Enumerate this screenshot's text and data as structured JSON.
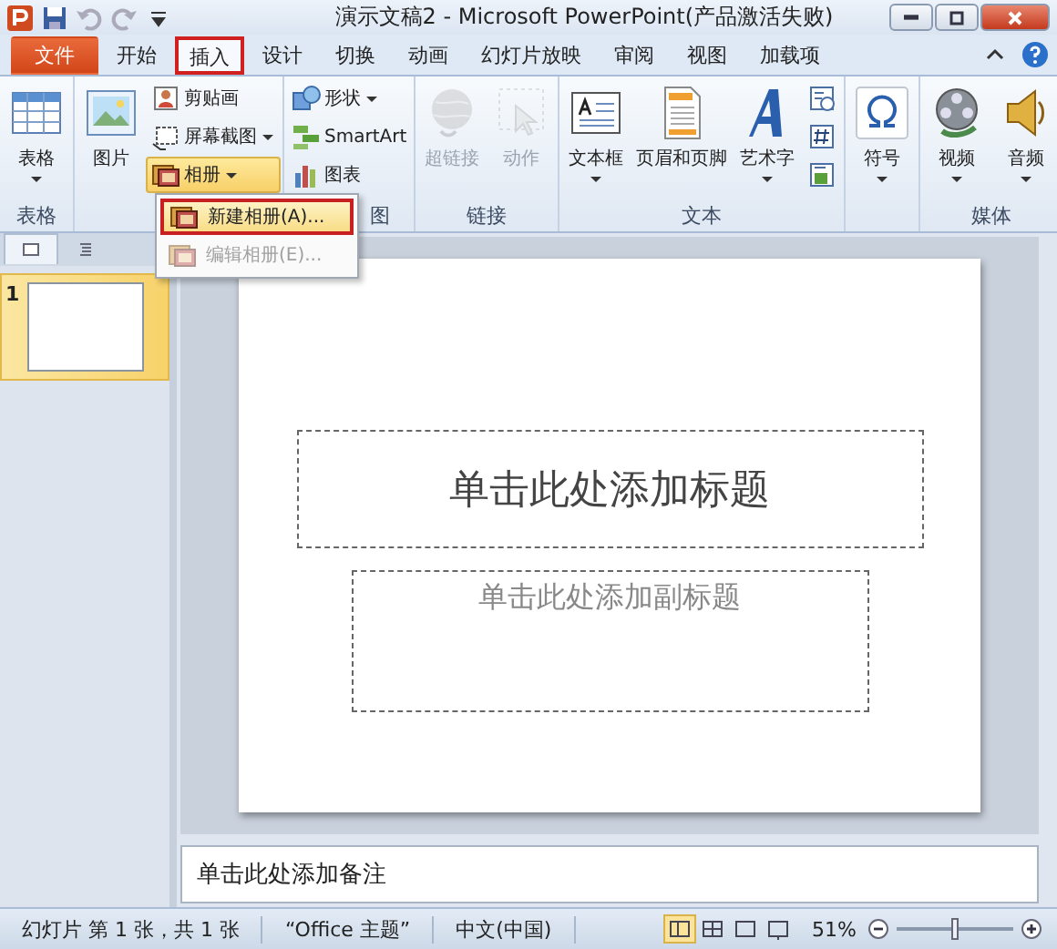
{
  "window": {
    "title": "演示文稿2 - Microsoft PowerPoint(产品激活失败)"
  },
  "tabs": [
    {
      "label": "文件",
      "kind": "file",
      "selected": false,
      "highlighted": false
    },
    {
      "label": "开始",
      "kind": "tab",
      "selected": false,
      "highlighted": false
    },
    {
      "label": "插入",
      "kind": "tab",
      "selected": true,
      "highlighted": true
    },
    {
      "label": "设计",
      "kind": "tab",
      "selected": false,
      "highlighted": false
    },
    {
      "label": "切换",
      "kind": "tab",
      "selected": false,
      "highlighted": false
    },
    {
      "label": "动画",
      "kind": "tab",
      "selected": false,
      "highlighted": false
    },
    {
      "label": "幻灯片放映",
      "kind": "tab",
      "selected": false,
      "highlighted": false
    },
    {
      "label": "审阅",
      "kind": "tab",
      "selected": false,
      "highlighted": false
    },
    {
      "label": "视图",
      "kind": "tab",
      "selected": false,
      "highlighted": false
    },
    {
      "label": "加载项",
      "kind": "tab",
      "selected": false,
      "highlighted": false
    }
  ],
  "ribbon": {
    "groups": [
      {
        "label": "表格",
        "items": [
          {
            "kind": "large",
            "label": "表格",
            "dropdown": true,
            "disabled": false,
            "selected": false
          }
        ]
      },
      {
        "items": [
          {
            "kind": "large",
            "label": "图片",
            "dropdown": false,
            "disabled": false,
            "selected": false
          },
          {
            "kind": "small",
            "label": "剪贴画",
            "dropdown": false,
            "disabled": false,
            "selected": false
          },
          {
            "kind": "small",
            "label": "屏幕截图",
            "dropdown": true,
            "disabled": false,
            "selected": false
          },
          {
            "kind": "small",
            "label": "相册",
            "dropdown": true,
            "disabled": false,
            "selected": true
          }
        ]
      },
      {
        "label": "图",
        "items": [
          {
            "kind": "small",
            "label": "形状",
            "dropdown": true,
            "disabled": false,
            "selected": false
          },
          {
            "kind": "small",
            "label": "SmartArt",
            "dropdown": false,
            "disabled": false,
            "selected": false
          },
          {
            "kind": "small",
            "label": "图表",
            "dropdown": false,
            "disabled": false,
            "selected": false
          }
        ]
      },
      {
        "label": "链接",
        "items": [
          {
            "kind": "large",
            "label": "超链接",
            "dropdown": false,
            "disabled": true,
            "selected": false
          },
          {
            "kind": "large",
            "label": "动作",
            "dropdown": false,
            "disabled": true,
            "selected": false
          }
        ]
      },
      {
        "label": "文本",
        "items": [
          {
            "kind": "large",
            "label": "文本框",
            "dropdown": true,
            "disabled": false,
            "selected": false
          },
          {
            "kind": "large",
            "label": "页眉和页脚",
            "dropdown": false,
            "disabled": false,
            "selected": false
          },
          {
            "kind": "large",
            "label": "艺术字",
            "dropdown": true,
            "disabled": false,
            "selected": false
          },
          {
            "kind": "icon",
            "dropdown": false,
            "disabled": false,
            "selected": false
          },
          {
            "kind": "icon",
            "dropdown": false,
            "disabled": false,
            "selected": false
          },
          {
            "kind": "icon",
            "dropdown": false,
            "disabled": false,
            "selected": false
          }
        ]
      },
      {
        "items": [
          {
            "kind": "large",
            "label": "符号",
            "dropdown": true,
            "disabled": false,
            "selected": false
          }
        ]
      },
      {
        "label": "媒体",
        "items": [
          {
            "kind": "large",
            "label": "视频",
            "dropdown": true,
            "disabled": false,
            "selected": false
          },
          {
            "kind": "large",
            "label": "音频",
            "dropdown": true,
            "disabled": false,
            "selected": false
          }
        ]
      }
    ]
  },
  "album_menu": [
    {
      "label": "新建相册(A)...",
      "disabled": false,
      "highlighted": true
    },
    {
      "label": "编辑相册(E)...",
      "disabled": true,
      "highlighted": false
    }
  ],
  "thumbnails": [
    {
      "number": "1",
      "selected": true
    }
  ],
  "slide": {
    "title_placeholder": "单击此处添加标题",
    "subtitle_placeholder": "单击此处添加副标题"
  },
  "notes": {
    "placeholder": "单击此处添加备注"
  },
  "status_bar": {
    "slide_info": "幻灯片 第 1 张，共 1 张",
    "theme": "“Office 主题”",
    "language": "中文(中国)",
    "views": [
      {
        "selected": true
      },
      {
        "selected": false
      },
      {
        "selected": false
      },
      {
        "selected": false
      }
    ],
    "zoom": "51%",
    "zoom_level": {
      "level": 0.5
    }
  }
}
